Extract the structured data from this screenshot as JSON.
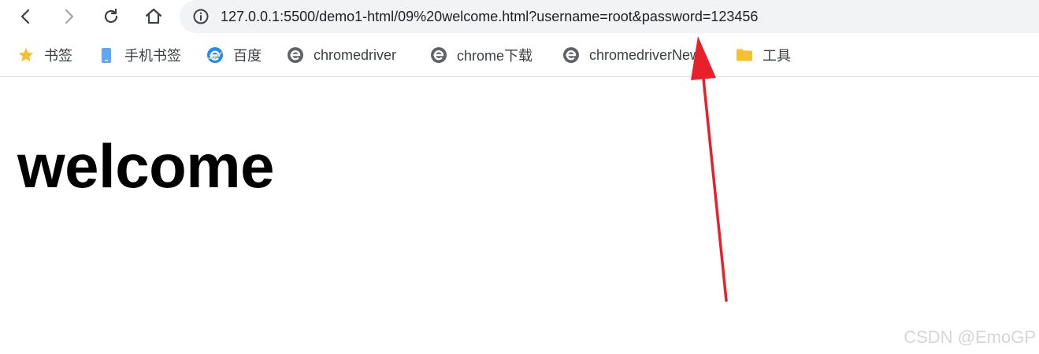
{
  "toolbar": {
    "url": "127.0.0.1:5500/demo1-html/09%20welcome.html?username=root&password=123456"
  },
  "bookmarks": [
    {
      "label": "书签",
      "icon": "star-icon"
    },
    {
      "label": "手机书签",
      "icon": "mobile-icon"
    },
    {
      "label": "百度",
      "icon": "browser-e-icon"
    },
    {
      "label": "chromedriver",
      "icon": "edge-e-icon"
    },
    {
      "label": "chrome下载",
      "icon": "edge-e-icon"
    },
    {
      "label": "chromedriverNew",
      "icon": "edge-e-icon"
    },
    {
      "label": "工具",
      "icon": "folder-icon"
    }
  ],
  "page": {
    "heading": "welcome"
  },
  "watermark": "CSDN @EmoGP",
  "colors": {
    "omnibox_bg": "#f1f3f4",
    "annotation_arrow": "#e8202a",
    "star": "#f6c02e",
    "folder": "#f6c02e",
    "mobile": "#5ba8f5",
    "baidu_e": "#1a8cff",
    "edge_e": "#5f6368"
  }
}
